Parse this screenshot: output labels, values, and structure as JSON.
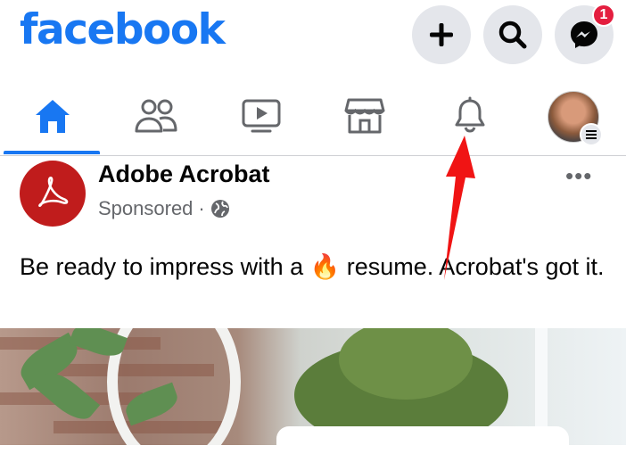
{
  "header": {
    "logo_text": "facebook",
    "create_icon": "plus-icon",
    "search_icon": "search-icon",
    "messenger_icon": "messenger-icon",
    "messenger_badge": "1"
  },
  "tabs": [
    {
      "name": "home",
      "icon": "home-icon",
      "active": true
    },
    {
      "name": "friends",
      "icon": "friends-icon",
      "active": false
    },
    {
      "name": "watch",
      "icon": "video-icon",
      "active": false
    },
    {
      "name": "marketplace",
      "icon": "store-icon",
      "active": false
    },
    {
      "name": "notifications",
      "icon": "bell-icon",
      "active": false
    },
    {
      "name": "menu",
      "icon": "avatar",
      "active": false
    }
  ],
  "post": {
    "author": "Adobe Acrobat",
    "sponsored_label": "Sponsored",
    "separator": "·",
    "text_before_emoji": "Be ready to impress with a ",
    "emoji": "🔥",
    "text_after_emoji": " resume. Acrobat's got it.",
    "more_label": "•••"
  },
  "colors": {
    "brand": "#1877f2",
    "badge": "#e41e3f",
    "arrow": "#f01414",
    "acrobat": "#c01c1c"
  }
}
